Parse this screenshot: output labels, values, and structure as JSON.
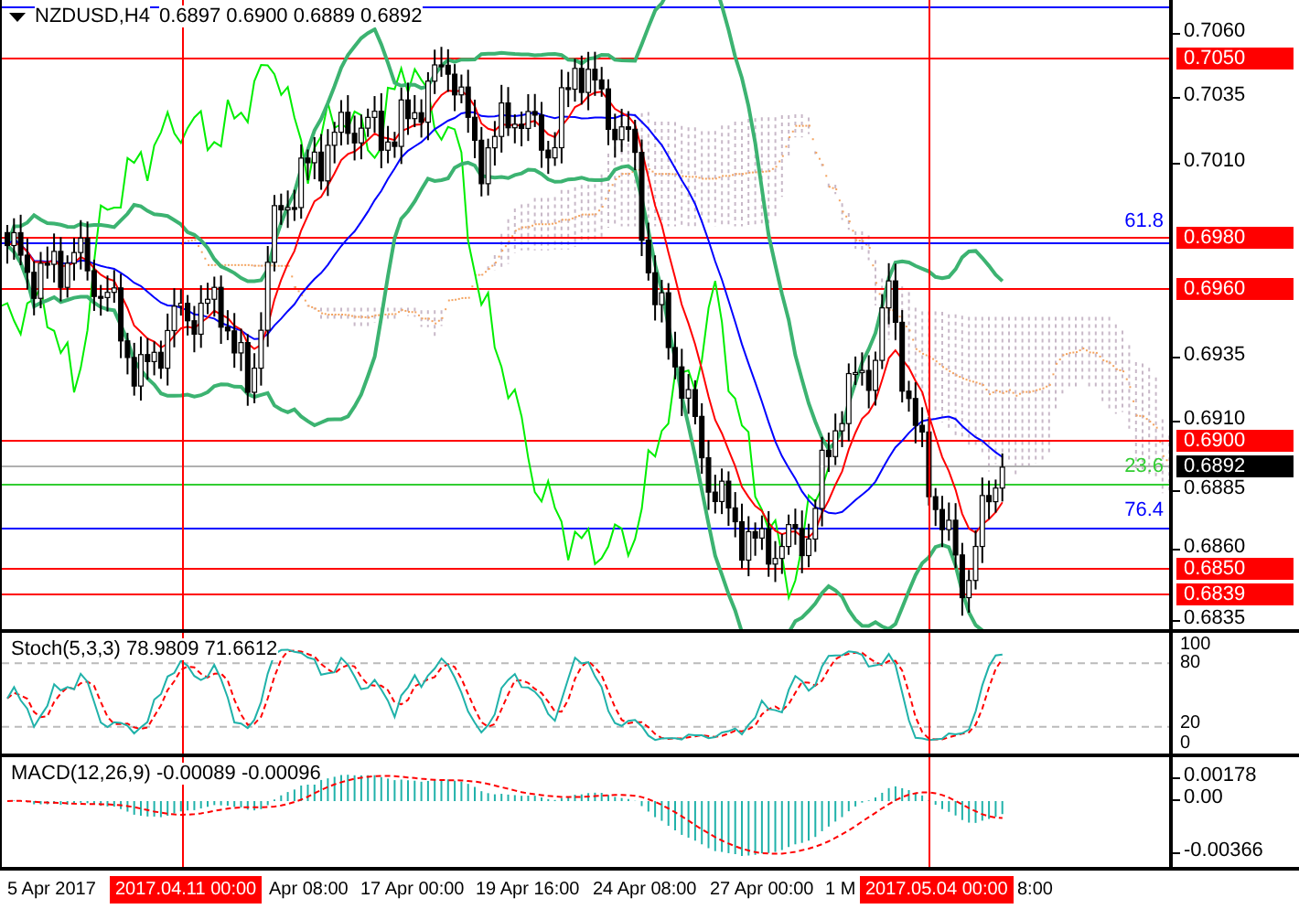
{
  "header": {
    "symbol": "NZDUSD,H4",
    "ohlc": "0.6897 0.6900 0.6889 0.6892"
  },
  "price_axis": {
    "ticks": [
      "0.7060",
      "0.7035",
      "0.7010",
      "0.6935",
      "0.6910",
      "0.6885",
      "0.6860",
      "0.6835"
    ]
  },
  "price_tags": [
    {
      "label": "0.7050",
      "kind": "level"
    },
    {
      "label": "0.6980",
      "kind": "level"
    },
    {
      "label": "0.6960",
      "kind": "level"
    },
    {
      "label": "0.6900",
      "kind": "level"
    },
    {
      "label": "0.6892",
      "kind": "current"
    },
    {
      "label": "0.6850",
      "kind": "level"
    },
    {
      "label": "0.6839",
      "kind": "level"
    }
  ],
  "fib_labels": [
    {
      "label": "61.8",
      "color": "#0000ff"
    },
    {
      "label": "23.6",
      "color": "#32cd32"
    },
    {
      "label": "76.4",
      "color": "#0000ff"
    }
  ],
  "stoch": {
    "title": "Stoch(5,3,3) 78.9809 71.6612",
    "ticks": [
      "100",
      "80",
      "20",
      "0"
    ]
  },
  "macd": {
    "title": "MACD(12,26,9) -0.00089 -0.00096",
    "ticks": [
      "0.00178",
      "0.00",
      "-0.00366"
    ]
  },
  "time_axis": [
    {
      "label": "5 Apr 2017",
      "kind": "tick"
    },
    {
      "label": "2017.04.11 00:00",
      "kind": "cursor"
    },
    {
      "label": "Apr 08:00",
      "kind": "tick"
    },
    {
      "label": "17 Apr 00:00",
      "kind": "tick"
    },
    {
      "label": "19 Apr 16:00",
      "kind": "tick"
    },
    {
      "label": "24 Apr 08:00",
      "kind": "tick"
    },
    {
      "label": "27 Apr 00:00",
      "kind": "tick"
    },
    {
      "label": "1 M",
      "kind": "tick"
    },
    {
      "label": "2017.05.04 00:00",
      "kind": "cursor"
    },
    {
      "label": "8:00",
      "kind": "tick"
    }
  ]
}
